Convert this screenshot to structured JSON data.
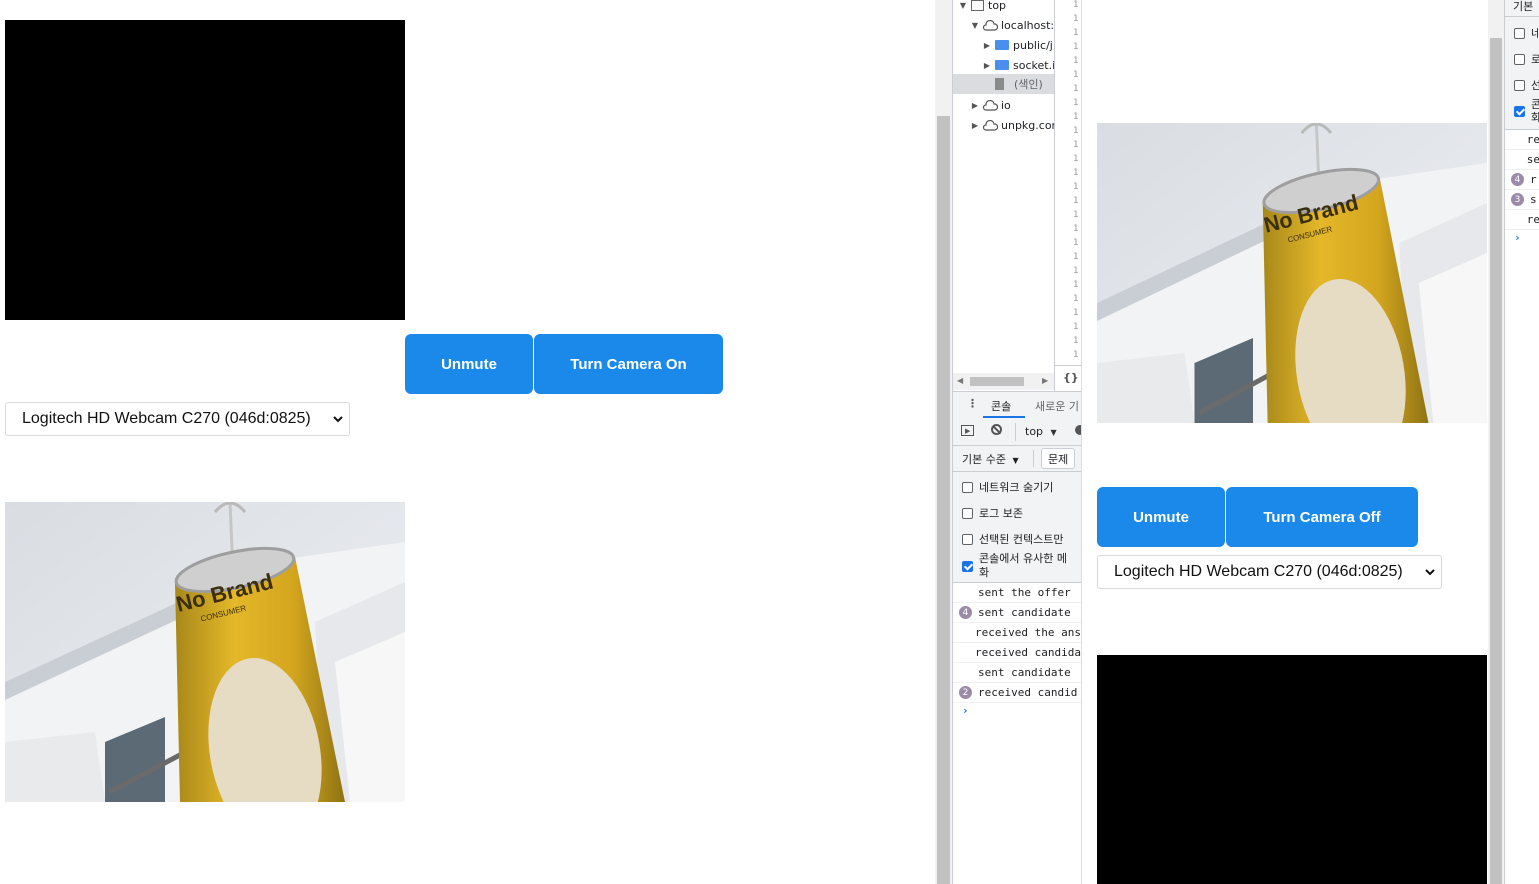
{
  "left_app": {
    "unmute_label": "Unmute",
    "camera_toggle_label": "Turn Camera On",
    "camera_select_value": "Logitech HD Webcam C270 (046d:0825)"
  },
  "right_app": {
    "unmute_label": "Unmute",
    "camera_toggle_label": "Turn Camera Off",
    "camera_select_value": "Logitech HD Webcam C270 (046d:0825)"
  },
  "camera_scene": {
    "can_label_line1": "No Brand",
    "can_label_line2": "CONSUMER"
  },
  "devtools": {
    "sources_tree": [
      {
        "label": "top"
      },
      {
        "label": "localhost:"
      },
      {
        "label": "public/j"
      },
      {
        "label": "socket.i"
      },
      {
        "label": "(색인)"
      },
      {
        "label": "io"
      },
      {
        "label": "unpkg.cor"
      }
    ],
    "line_numbers": [
      "1",
      "1",
      "1",
      "1",
      "1",
      "1",
      "1",
      "1",
      "1",
      "1",
      "1",
      "1",
      "1",
      "1",
      "1",
      "1",
      "1",
      "1",
      "1",
      "1",
      "1",
      "1",
      "1",
      "1",
      "1",
      "1"
    ],
    "format_label": "{}",
    "tabs": {
      "console": "콘솔",
      "whats_new": "새로운 기"
    },
    "context_label": "top",
    "levels_label": "기본 수준",
    "issues_label": "문제",
    "settings": [
      {
        "label": "네트워크 숨기기",
        "checked": false
      },
      {
        "label": "로그 보존",
        "checked": false
      },
      {
        "label": "선택된 컨텍스트만",
        "checked": false
      },
      {
        "label": "콘솔에서 유사한 메",
        "label2": "화",
        "checked": true
      }
    ],
    "logs": [
      {
        "count": "",
        "text": "sent the offer"
      },
      {
        "count": "4",
        "text": "sent candidate"
      },
      {
        "count": "",
        "text": "received the ans"
      },
      {
        "count": "",
        "text": "received candida"
      },
      {
        "count": "",
        "text": "sent candidate"
      },
      {
        "count": "2",
        "text": "received candid"
      }
    ],
    "prompt": "›"
  },
  "devtools_right": {
    "header_label": "기본",
    "settings": [
      {
        "label": "네",
        "checked": false
      },
      {
        "label": "로",
        "checked": false
      },
      {
        "label": "선",
        "checked": false
      },
      {
        "label": "콘",
        "label2": "화",
        "checked": true
      }
    ],
    "logs": [
      {
        "count": "",
        "text": "re"
      },
      {
        "count": "",
        "text": "se"
      },
      {
        "count": "4",
        "text": "r"
      },
      {
        "count": "3",
        "text": "s"
      },
      {
        "count": "",
        "text": "re"
      }
    ],
    "prompt": "›"
  }
}
